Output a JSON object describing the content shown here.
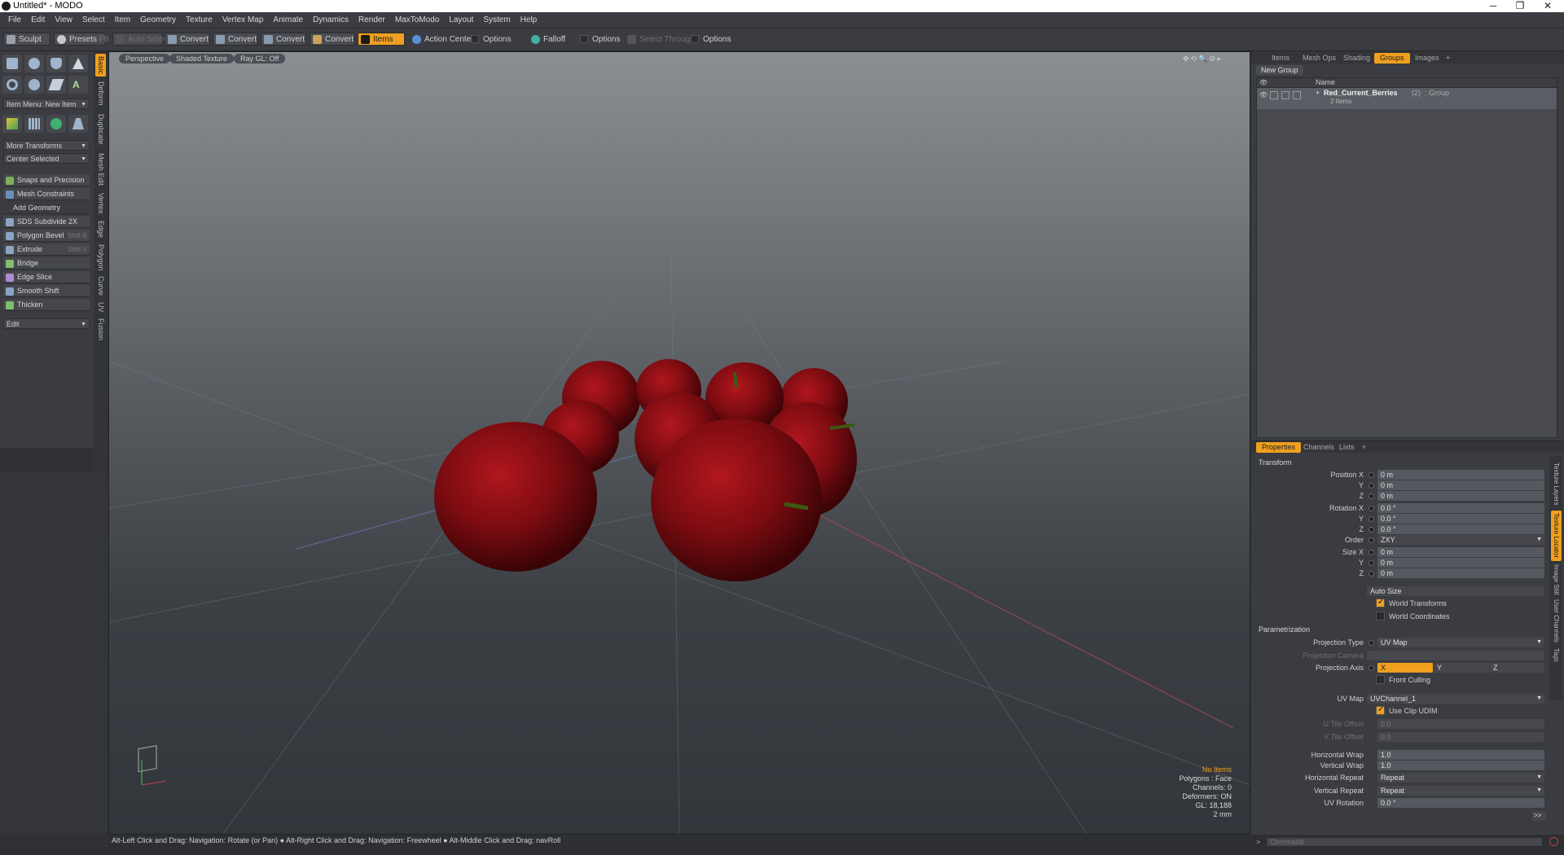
{
  "window": {
    "title": "Untitled* - MODO",
    "minimize": "─",
    "restore": "❐",
    "close": "✕"
  },
  "menu": [
    "File",
    "Edit",
    "View",
    "Select",
    "Item",
    "Geometry",
    "Texture",
    "Vertex Map",
    "Animate",
    "Dynamics",
    "Render",
    "MaxToModo",
    "Layout",
    "System",
    "Help"
  ],
  "toolbar": {
    "sculpt": "Sculpt",
    "presets": "Presets",
    "presets_key": "F6",
    "auto_select": "Auto Select",
    "convert1": "Convert",
    "convert2": "Convert",
    "convert3": "Convert",
    "convert4": "Convert",
    "items": "Items",
    "action_center": "Action Center",
    "options1": "Options",
    "falloff": "Falloff",
    "options2": "Options",
    "select_through": "Select Through",
    "options3": "Options"
  },
  "left": {
    "item_menu": "Item Menu: New Item",
    "more_transforms": "More Transforms",
    "center_selected": "Center Selected",
    "snaps": "Snaps and Precision",
    "mesh_constraints": "Mesh Constraints",
    "add_geometry": "Add Geometry",
    "tools": [
      {
        "label": "SDS Subdivide 2X",
        "shortcut": ""
      },
      {
        "label": "Polygon Bevel",
        "shortcut": "Shift-B"
      },
      {
        "label": "Extrude",
        "shortcut": "Shift-X"
      },
      {
        "label": "Bridge",
        "shortcut": ""
      },
      {
        "label": "Edge Slice",
        "shortcut": ""
      },
      {
        "label": "Smooth Shift",
        "shortcut": ""
      },
      {
        "label": "Thicken",
        "shortcut": ""
      }
    ],
    "edit": "Edit",
    "vtabs": [
      "Basic",
      "Deform",
      "Duplicate",
      "Mesh Edit",
      "Vertex",
      "Edge",
      "Polygon",
      "Curve",
      "UV",
      "Fusion"
    ]
  },
  "viewport": {
    "perspective": "Perspective",
    "shading": "Shaded Texture",
    "raygl": "Ray GL: Off",
    "hud": {
      "no_items": "No Items",
      "polygons": "Polygons : Face",
      "channels": "Channels: 0",
      "deformers": "Deformers: ON",
      "gl": "GL: 18,188",
      "unit": "2 mm"
    }
  },
  "items_panel": {
    "tabs": [
      "Items",
      "Mesh Ops",
      "Shading",
      "Groups",
      "Images"
    ],
    "add_tab": "+",
    "new_group": "New Group",
    "col_name": "Name",
    "group_name": "Red_Current_Berries",
    "group_count": "(2)",
    "group_type": ": Group",
    "group_items": "2 Items"
  },
  "props": {
    "tabs": [
      "Properties",
      "Channels",
      "Lists"
    ],
    "add_tab": "+",
    "side_tabs": [
      "Texture Layers",
      "Texture Locator",
      "Image Still",
      "User Channels",
      "Tags"
    ],
    "transform": "Transform",
    "position_x": "Position X",
    "y": "Y",
    "z": "Z",
    "pos_x_val": "0 m",
    "pos_y_val": "0 m",
    "pos_z_val": "0 m",
    "rotation_x": "Rotation X",
    "rot_x_val": "0.0 °",
    "rot_y_val": "0.0 °",
    "rot_z_val": "0.0 °",
    "order": "Order",
    "order_val": "ZXY",
    "size_x": "Size X",
    "size_x_val": "0 m",
    "size_y_val": "0 m",
    "size_z_val": "0 m",
    "auto_size": "Auto Size",
    "world_transforms": "World Transforms",
    "world_coordinates": "World Coordinates",
    "parametrization": "Parametrization",
    "projection_type": "Projection Type",
    "projection_type_val": "UV Map",
    "projection_camera": "Projection Camera",
    "projection_axis": "Projection Axis",
    "axis_x": "X",
    "axis_y": "Y",
    "axis_z": "Z",
    "front_culling": "Front Culling",
    "uv_map": "UV Map",
    "uv_map_val": "UVChannel_1",
    "use_clip_udim": "Use Clip UDIM",
    "u_tile_offset": "U Tile Offset",
    "u_tile_val": "0.0",
    "v_tile_offset": "V Tile Offset",
    "v_tile_val": "0.0",
    "horizontal_wrap": "Horizontal Wrap",
    "hwrap_val": "1.0",
    "vertical_wrap": "Vertical Wrap",
    "vwrap_val": "1.0",
    "horizontal_repeat": "Horizontal Repeat",
    "hrepeat_val": "Repeat",
    "vertical_repeat": "Vertical Repeat",
    "vrepeat_val": "Repeat",
    "uv_rotation": "UV Rotation",
    "uvrot_val": "0.0 °",
    "more": ">>"
  },
  "status": "Alt-Left Click and Drag: Navigation: Rotate (or Pan) ● Alt-Right Click and Drag: Navigation: Freewheel ● Alt-Middle Click and Drag: navRoll",
  "command_placeholder": "Command",
  "colors": {
    "accent": "#f0a01e",
    "berry": "#8a1015",
    "stem": "#3d5a12"
  }
}
